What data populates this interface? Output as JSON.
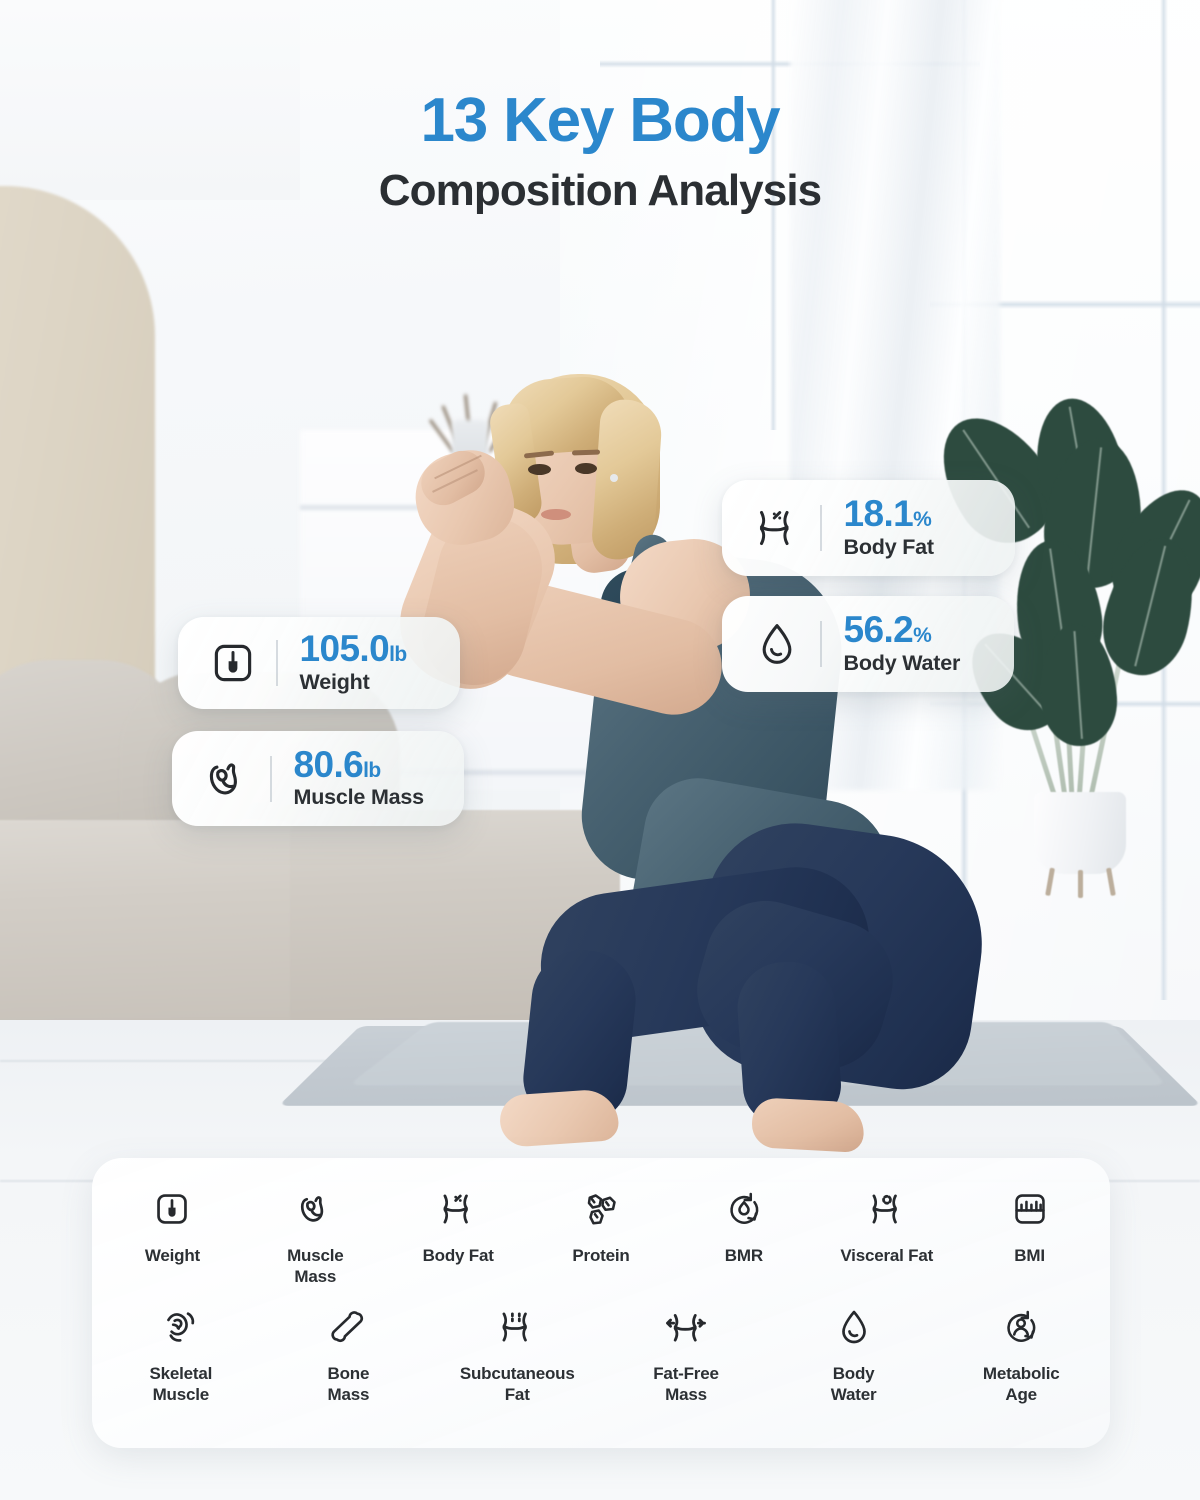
{
  "title": {
    "main": "13 Key Body",
    "sub": "Composition Analysis",
    "accent_color": "#2b87cc",
    "sub_color": "#2b2f33"
  },
  "badges": [
    {
      "id": "weight",
      "icon": "scale-icon",
      "value": "105.0",
      "unit": "lb",
      "label": "Weight"
    },
    {
      "id": "muscle",
      "icon": "muscle-icon",
      "value": "80.6",
      "unit": "lb",
      "label": "Muscle Mass"
    },
    {
      "id": "bodyfat",
      "icon": "body-fat-icon",
      "value": "18.1",
      "unit": "%",
      "label": "Body Fat"
    },
    {
      "id": "bodywater",
      "icon": "water-drop-icon",
      "value": "56.2",
      "unit": "%",
      "label": "Body Water"
    }
  ],
  "features": {
    "row1": [
      {
        "icon": "scale-icon",
        "label": "Weight"
      },
      {
        "icon": "muscle-icon",
        "label": "Muscle Mass"
      },
      {
        "icon": "body-fat-icon",
        "label": "Body Fat"
      },
      {
        "icon": "protein-icon",
        "label": "Protein"
      },
      {
        "icon": "bmr-flame-icon",
        "label": "BMR"
      },
      {
        "icon": "visceral-fat-icon",
        "label": "Visceral Fat"
      },
      {
        "icon": "bmi-icon",
        "label": "BMI"
      }
    ],
    "row2": [
      {
        "icon": "skeletal-muscle-icon",
        "label": "Skeletal\nMuscle"
      },
      {
        "icon": "bone-icon",
        "label": "Bone\nMass"
      },
      {
        "icon": "subcutaneous-fat-icon",
        "label": "Subcutaneous\nFat"
      },
      {
        "icon": "fat-free-mass-icon",
        "label": "Fat-Free\nMass"
      },
      {
        "icon": "water-drop-icon",
        "label": "Body\nWater"
      },
      {
        "icon": "metabolic-age-icon",
        "label": "Metabolic\nAge"
      }
    ]
  },
  "scene": {
    "description": "Woman in blue tank top and navy leggings doing a squat on a grey yoga mat in a bright living room",
    "wall_color": "#ddd5c5",
    "sofa_color": "#d2cdc6",
    "mat_color": "#c4ccd2",
    "plant_leaf_color": "#2d4b3f",
    "top_color": "#486271",
    "leggings_color": "#27395a"
  }
}
